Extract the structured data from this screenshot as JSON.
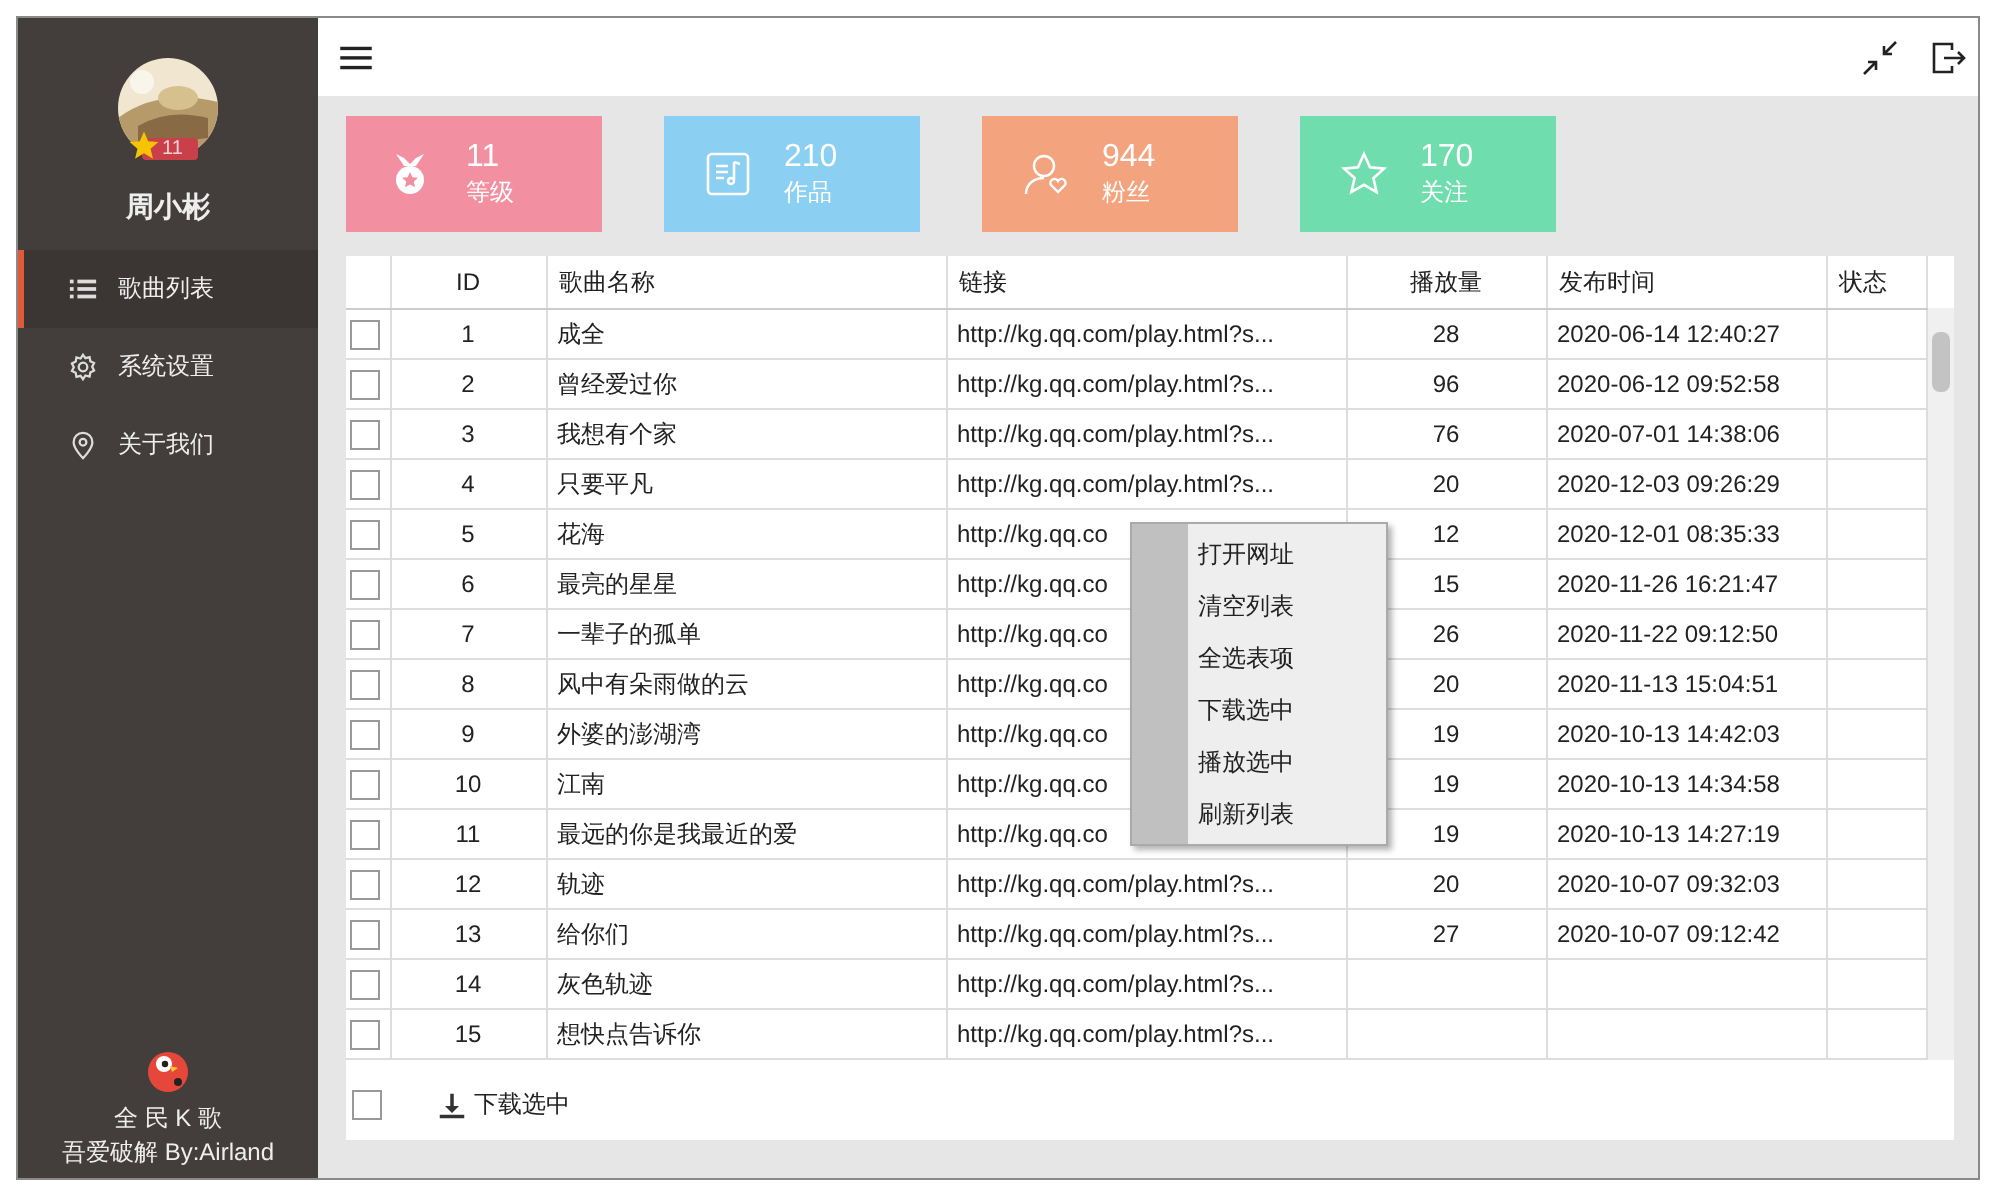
{
  "user": {
    "name": "周小彬",
    "level": "11"
  },
  "sidebar": {
    "items": [
      {
        "label": "歌曲列表",
        "kind": "list",
        "selected": true
      },
      {
        "label": "系统设置",
        "kind": "gear",
        "selected": false
      },
      {
        "label": "关于我们",
        "kind": "pin",
        "selected": false
      }
    ]
  },
  "app": {
    "name": "全 民 K 歌",
    "credit": "吾爱破解 By:Airland"
  },
  "stats": [
    {
      "value": "11",
      "label": "等级",
      "kind": "medal",
      "color": "#f28fa0"
    },
    {
      "value": "210",
      "label": "作品",
      "kind": "music",
      "color": "#8bcff2"
    },
    {
      "value": "944",
      "label": "粉丝",
      "kind": "fans",
      "color": "#f4a37f"
    },
    {
      "value": "170",
      "label": "关注",
      "kind": "star",
      "color": "#70ddae"
    }
  ],
  "table": {
    "columns": [
      "ID",
      "歌曲名称",
      "链接",
      "播放量",
      "发布时间",
      "状态"
    ],
    "rows": [
      {
        "checked": false,
        "id": "1",
        "name": "成全",
        "link": "http://kg.qq.com/play.html?s...",
        "plays": "28",
        "date": "2020-06-14 12:40:27"
      },
      {
        "checked": false,
        "id": "2",
        "name": "曾经爱过你",
        "link": "http://kg.qq.com/play.html?s...",
        "plays": "96",
        "date": "2020-06-12 09:52:58"
      },
      {
        "checked": false,
        "id": "3",
        "name": "我想有个家",
        "link": "http://kg.qq.com/play.html?s...",
        "plays": "76",
        "date": "2020-07-01 14:38:06"
      },
      {
        "checked": false,
        "id": "4",
        "name": "只要平凡",
        "link": "http://kg.qq.com/play.html?s...",
        "plays": "20",
        "date": "2020-12-03 09:26:29"
      },
      {
        "checked": false,
        "id": "5",
        "name": "花海",
        "link": "http://kg.qq.co",
        "plays": "12",
        "date": "2020-12-01 08:35:33"
      },
      {
        "checked": false,
        "id": "6",
        "name": "最亮的星星",
        "link": "http://kg.qq.co",
        "plays": "15",
        "date": "2020-11-26 16:21:47"
      },
      {
        "checked": false,
        "id": "7",
        "name": "一辈子的孤单",
        "link": "http://kg.qq.co",
        "plays": "26",
        "date": "2020-11-22 09:12:50"
      },
      {
        "checked": false,
        "id": "8",
        "name": "风中有朵雨做的云",
        "link": "http://kg.qq.co",
        "plays": "20",
        "date": "2020-11-13 15:04:51"
      },
      {
        "checked": false,
        "id": "9",
        "name": "外婆的澎湖湾",
        "link": "http://kg.qq.co",
        "plays": "19",
        "date": "2020-10-13 14:42:03"
      },
      {
        "checked": false,
        "id": "10",
        "name": "江南",
        "link": "http://kg.qq.co",
        "plays": "19",
        "date": "2020-10-13 14:34:58"
      },
      {
        "checked": false,
        "id": "11",
        "name": "最远的你是我最近的爱",
        "link": "http://kg.qq.co",
        "plays": "19",
        "date": "2020-10-13 14:27:19"
      },
      {
        "checked": false,
        "id": "12",
        "name": "轨迹",
        "link": "http://kg.qq.com/play.html?s...",
        "plays": "20",
        "date": "2020-10-07 09:32:03"
      },
      {
        "checked": false,
        "id": "13",
        "name": "给你们",
        "link": "http://kg.qq.com/play.html?s...",
        "plays": "27",
        "date": "2020-10-07 09:12:42"
      },
      {
        "checked": false,
        "id": "14",
        "name": "灰色轨迹",
        "link": "http://kg.qq.com/play.html?s..."
      },
      {
        "checked": false,
        "id": "15",
        "name": "想快点告诉你",
        "link": "http://kg.qq.com/play.html?s..."
      }
    ]
  },
  "footer": {
    "select_all_checked": false,
    "download_button": "下载选中"
  },
  "context_menu": {
    "items": [
      "打开网址",
      "清空列表",
      "全选表项",
      "下载选中",
      "播放选中",
      "刷新列表"
    ]
  }
}
